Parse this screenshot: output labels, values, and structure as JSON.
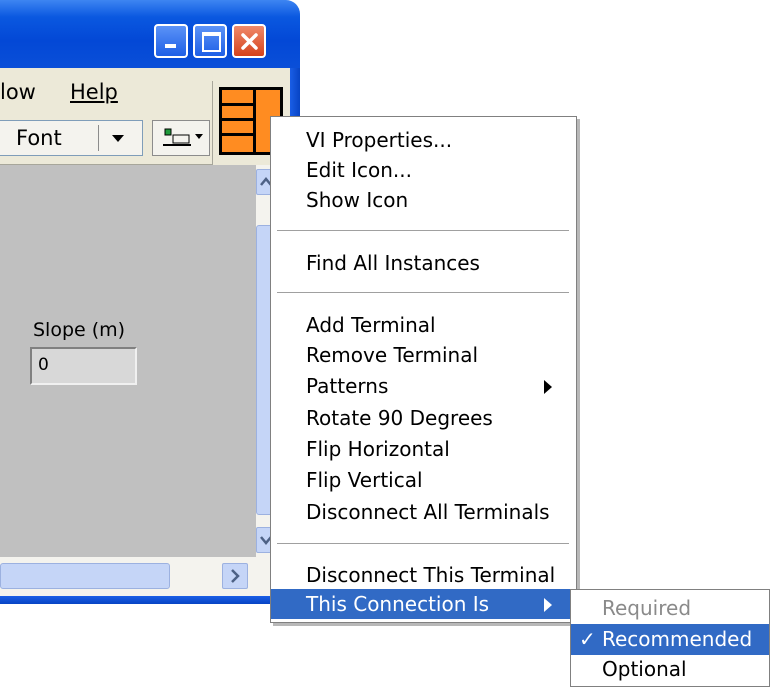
{
  "menubar": {
    "window": "low",
    "help": "Help"
  },
  "toolbar": {
    "font": "Font"
  },
  "panel": {
    "slope_label": "Slope (m)",
    "slope_value": "0"
  },
  "context_menu": {
    "items": [
      "VI Properties...",
      "Edit Icon...",
      "Show Icon",
      "Find All Instances",
      "Add Terminal",
      "Remove Terminal",
      "Patterns",
      "Rotate 90 Degrees",
      "Flip Horizontal",
      "Flip Vertical",
      "Disconnect All Terminals",
      "Disconnect This Terminal",
      "This Connection Is"
    ]
  },
  "submenu": {
    "items": [
      "Required",
      "Recommended",
      "Optional"
    ],
    "checked": "✓"
  },
  "colors": {
    "titlebar": "#0348d6",
    "connector_pane": "#ff8c21",
    "selection": "#316ac5",
    "panel": "#c0c0c0"
  }
}
